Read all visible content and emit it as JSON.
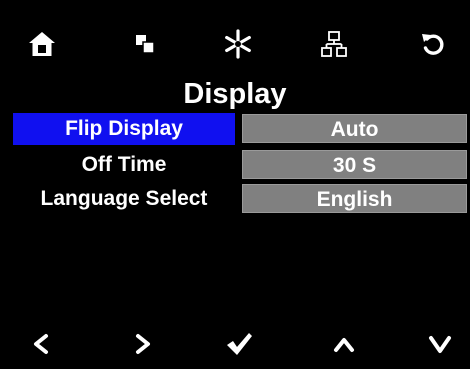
{
  "top_bar": {
    "icons": [
      "home-icon",
      "copy-icon",
      "asterisk-icon",
      "network-icon",
      "undo-icon"
    ]
  },
  "page": {
    "title": "Display"
  },
  "settings": [
    {
      "label": "Flip Display",
      "value": "Auto",
      "selected": true
    },
    {
      "label": "Off Time",
      "value": "30 S",
      "selected": false
    },
    {
      "label": "Language Select",
      "value": "English",
      "selected": false
    }
  ],
  "bottom_bar": {
    "icons": [
      "left-arrow-icon",
      "right-arrow-icon",
      "checkmark-icon",
      "up-arrow-icon",
      "down-arrow-icon"
    ]
  },
  "colors": {
    "background": "#000000",
    "selected": "#1010f0",
    "value_box": "#808080",
    "text": "#ffffff"
  }
}
